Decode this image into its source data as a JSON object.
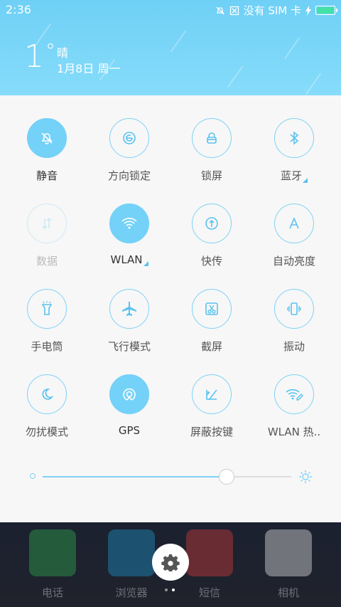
{
  "status_bar": {
    "time": "2:36",
    "carrier_text": "没有 SIM 卡"
  },
  "weather": {
    "temperature": "1",
    "degree_symbol": "°",
    "condition": "晴",
    "date": "1月8日 周一"
  },
  "tiles": [
    {
      "label": "静音",
      "icon": "bell-off-icon",
      "state": "active"
    },
    {
      "label": "方向锁定",
      "icon": "rotation-lock-icon",
      "state": "inactive"
    },
    {
      "label": "锁屏",
      "icon": "lock-icon",
      "state": "inactive"
    },
    {
      "label": "蓝牙",
      "icon": "bluetooth-icon",
      "state": "inactive",
      "has_more": true
    },
    {
      "label": "数据",
      "icon": "mobile-data-icon",
      "state": "disabled"
    },
    {
      "label": "WLAN",
      "icon": "wifi-icon",
      "state": "active",
      "has_more": true
    },
    {
      "label": "快传",
      "icon": "quick-send-icon",
      "state": "inactive"
    },
    {
      "label": "自动亮度",
      "icon": "auto-brightness-icon",
      "state": "inactive"
    },
    {
      "label": "手电筒",
      "icon": "flashlight-icon",
      "state": "inactive"
    },
    {
      "label": "飞行模式",
      "icon": "airplane-icon",
      "state": "inactive"
    },
    {
      "label": "截屏",
      "icon": "screenshot-icon",
      "state": "inactive"
    },
    {
      "label": "振动",
      "icon": "vibrate-icon",
      "state": "inactive"
    },
    {
      "label": "勿扰模式",
      "icon": "moon-icon",
      "state": "inactive"
    },
    {
      "label": "GPS",
      "icon": "gps-icon",
      "state": "active"
    },
    {
      "label": "屏蔽按键",
      "icon": "block-keys-icon",
      "state": "inactive"
    },
    {
      "label": "WLAN 热..",
      "icon": "hotspot-icon",
      "state": "inactive"
    }
  ],
  "brightness": {
    "level": 0.74
  },
  "dock": {
    "apps": [
      {
        "label": "电话",
        "icon": "phone-icon",
        "color": "#2fa24c"
      },
      {
        "label": "浏览器",
        "icon": "compass-icon",
        "color": "#1d8fc2"
      },
      {
        "label": "短信",
        "icon": "message-icon",
        "color": "#c83a3a"
      },
      {
        "label": "相机",
        "icon": "camera-icon",
        "color": "#d9d9d9"
      }
    ]
  },
  "colors": {
    "accent": "#74d1f8",
    "header": "#7bd6f8",
    "battery": "#43e1a6"
  }
}
